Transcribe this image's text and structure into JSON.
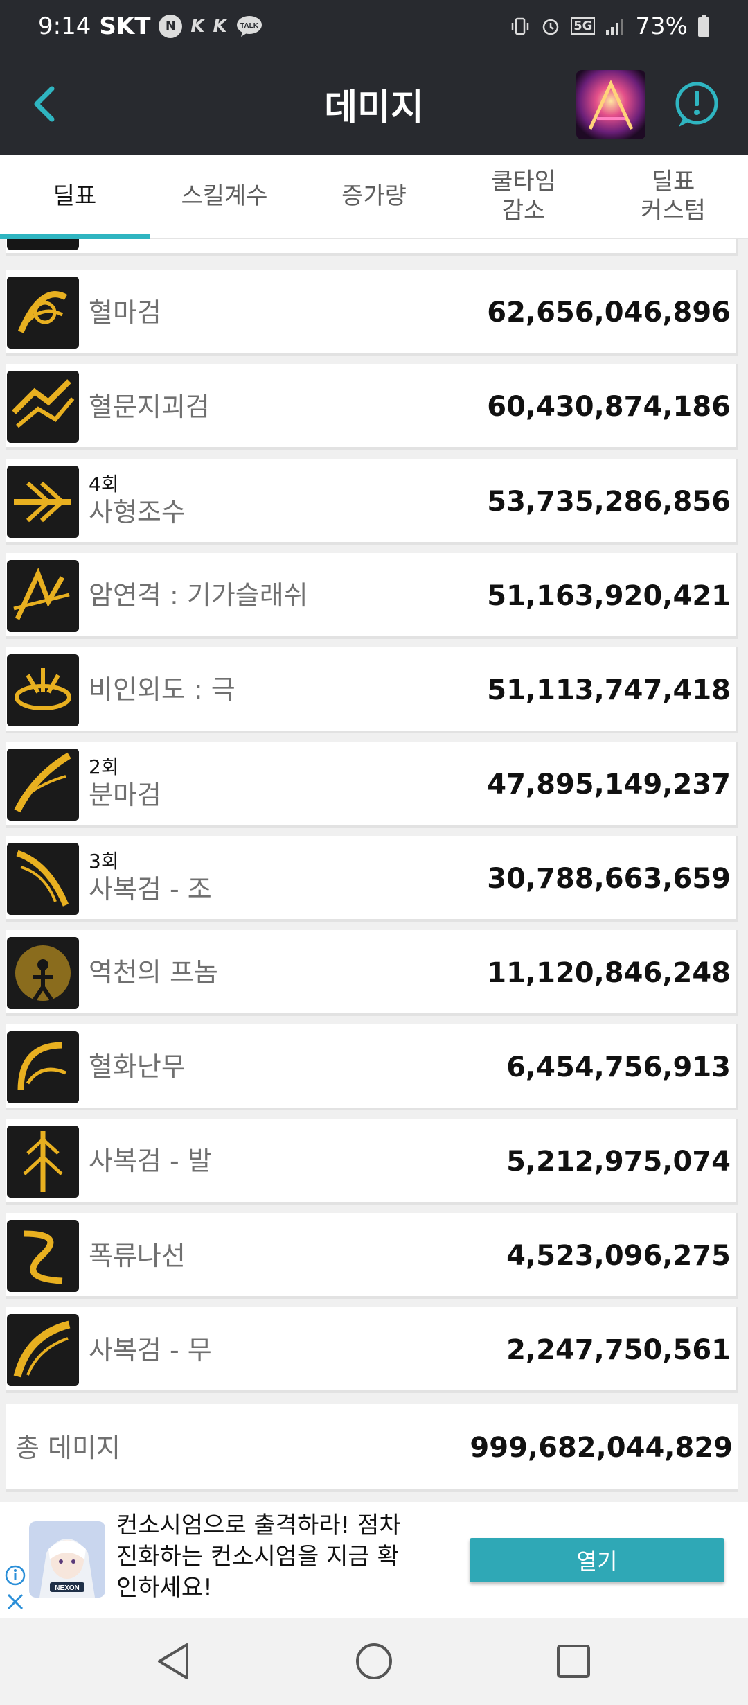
{
  "status": {
    "time": "9:14",
    "carrier": "SKT",
    "network": "5G",
    "battery": "73%",
    "icons": [
      "naver-icon",
      "k-app-icon",
      "k-app-icon",
      "kakaotalk-icon",
      "vibrate-icon",
      "alarm-icon",
      "signal-icon",
      "battery-icon"
    ]
  },
  "header": {
    "title": "데미지",
    "back_icon": "chevron-left-icon",
    "info_icon": "exclamation-circle-icon"
  },
  "tabs": [
    {
      "label": "딜표",
      "active": true
    },
    {
      "label": "스킬계수",
      "active": false
    },
    {
      "label": "증가량",
      "active": false
    },
    {
      "label": "쿨타임\n감소",
      "active": false
    },
    {
      "label": "딜표\n커스텀",
      "active": false
    }
  ],
  "skills": [
    {
      "name": "혈마검",
      "hits": "",
      "damage": "62,656,046,896"
    },
    {
      "name": "혈문지괴검",
      "hits": "",
      "damage": "60,430,874,186"
    },
    {
      "name": "사형조수",
      "hits": "4회",
      "damage": "53,735,286,856"
    },
    {
      "name": "암연격 : 기가슬래쉬",
      "hits": "",
      "damage": "51,163,920,421"
    },
    {
      "name": "비인외도 : 극",
      "hits": "",
      "damage": "51,113,747,418"
    },
    {
      "name": "분마검",
      "hits": "2회",
      "damage": "47,895,149,237"
    },
    {
      "name": "사복검 - 조",
      "hits": "3회",
      "damage": "30,788,663,659"
    },
    {
      "name": "역천의 프놈",
      "hits": "",
      "damage": "11,120,846,248"
    },
    {
      "name": "혈화난무",
      "hits": "",
      "damage": "6,454,756,913"
    },
    {
      "name": "사복검 - 발",
      "hits": "",
      "damage": "5,212,975,074"
    },
    {
      "name": "폭류나선",
      "hits": "",
      "damage": "4,523,096,275"
    },
    {
      "name": "사복검 - 무",
      "hits": "",
      "damage": "2,247,750,561"
    }
  ],
  "total": {
    "label": "총 데미지",
    "value": "999,682,044,829"
  },
  "ad": {
    "text": "컨소시엄으로 출격하라! 점차 진화하는 컨소시엄을 지금 확인하세요!",
    "button": "열기",
    "brand": "NEXON"
  },
  "colors": {
    "dark_bar": "#282a2f",
    "accent": "#2fb5c1",
    "icon_gold": "#e8b020"
  }
}
